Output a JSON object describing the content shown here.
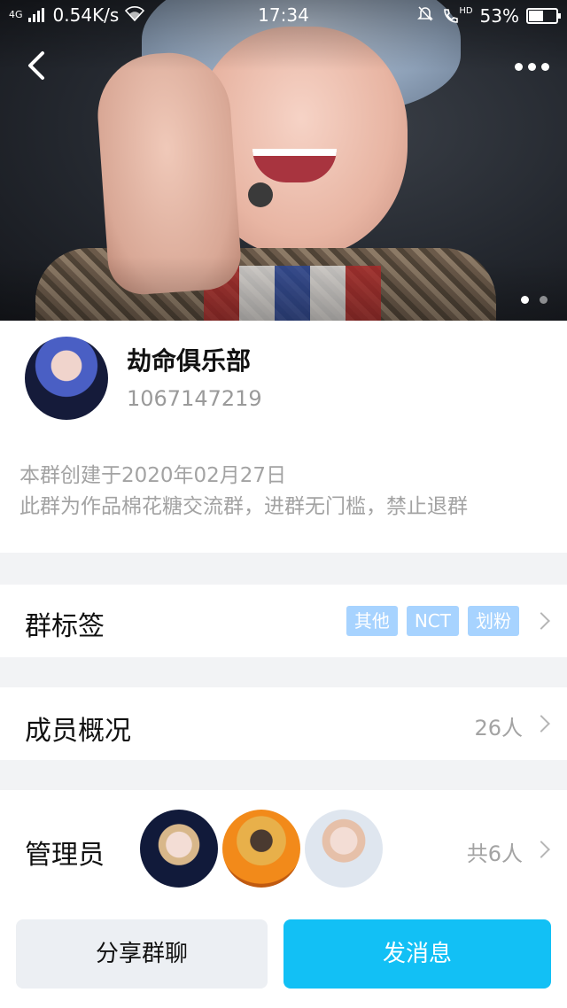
{
  "status_bar": {
    "network": "4G",
    "speed": "0.54K/s",
    "time": "17:34",
    "hd": "HD",
    "battery_percent": "53%",
    "battery_level": 0.53
  },
  "hero": {
    "slide_count": 2,
    "active_slide": 1
  },
  "group": {
    "name": "劫命俱乐部",
    "id": "1067147219",
    "created": "本群创建于2020年02月27日",
    "description": "此群为作品棉花糖交流群，进群无门槛，禁止退群"
  },
  "tags_row": {
    "label": "群标签",
    "tags": [
      "其他",
      "NCT",
      "划粉"
    ]
  },
  "members_row": {
    "label": "成员概况",
    "count": "26人"
  },
  "admins_row": {
    "label": "管理员",
    "count": "共6人"
  },
  "actions": {
    "share": "分享群聊",
    "send": "发消息"
  },
  "colors": {
    "accent": "#12c0f5",
    "tag_bg": "#a7d3ff"
  }
}
